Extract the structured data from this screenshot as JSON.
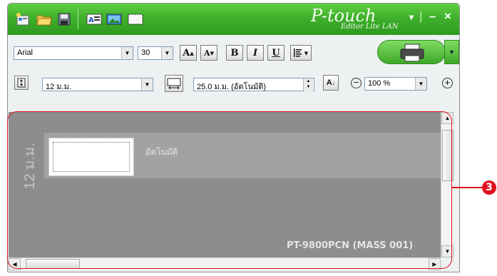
{
  "app": {
    "logo_text": "P-touch",
    "subtitle": "Editor Lite LAN",
    "window_controls": [
      "▾",
      "|",
      "–",
      "×"
    ]
  },
  "icons": {
    "new": "new-label-icon",
    "open": "open-folder-icon",
    "save": "save-disk-icon",
    "text": "insert-text-icon",
    "image": "insert-image-icon",
    "frame": "insert-frame-icon",
    "print": "printer-icon"
  },
  "format": {
    "font_value": "Arial",
    "size_value": "30",
    "grow_font_label": "A",
    "shrink_font_label": "A",
    "bold_label": "B",
    "italic_label": "I",
    "underline_label": "U"
  },
  "layout": {
    "tape_width_value": "12 ม.ม.",
    "length_value": "25.0 ม.ม. (อัตโนมัติ)",
    "zoom_value": "100 %"
  },
  "canvas": {
    "tape_length_label": "12 ม.ม.",
    "auto_text": "อัตโนมัติ",
    "printer_label": "PT-9800PCN (MASS 001)"
  },
  "callout": {
    "number": "3"
  },
  "colors": {
    "title_green": "#3fb02c",
    "canvas_gray": "#8d8d8d",
    "callout_red": "#e0101f"
  }
}
